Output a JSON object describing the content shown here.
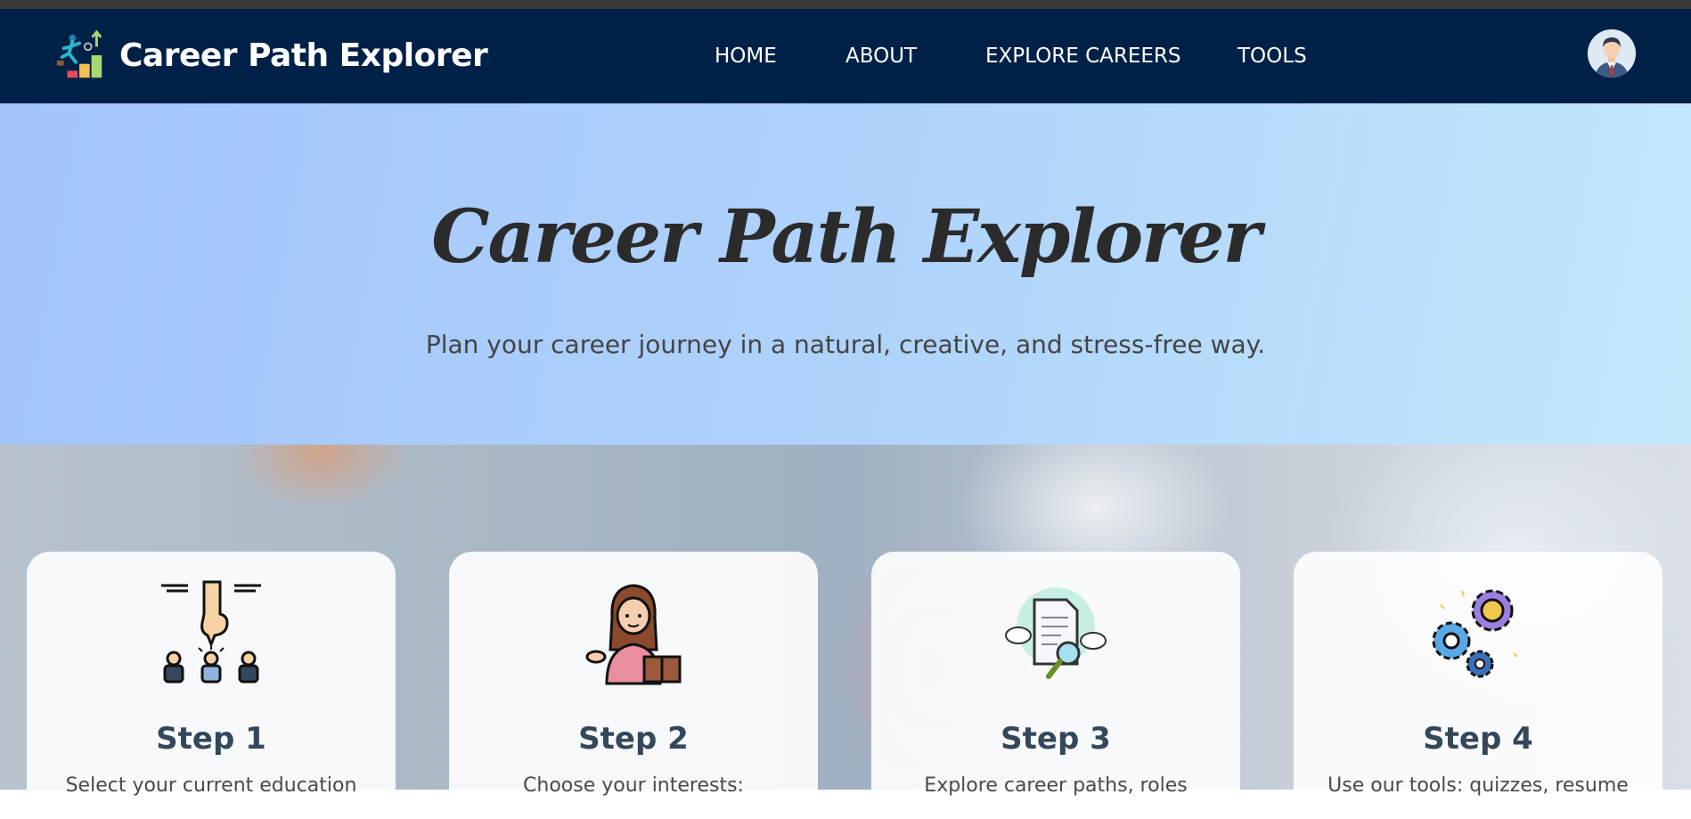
{
  "header": {
    "brand_title": "Career Path Explorer",
    "brand_icon": "career-ladder-runner-icon",
    "nav": [
      "HOME",
      "ABOUT",
      "EXPLORE CAREERS",
      "TOOLS"
    ],
    "avatar_icon": "user-avatar-icon",
    "bg_color": "#002147"
  },
  "hero": {
    "title": "Career Path Explorer",
    "subtitle": "Plan your career journey in a natural, creative, and stress-free way."
  },
  "steps": [
    {
      "title": "Step 1",
      "text": "Select your current education",
      "icon": "selection-pointer-icon"
    },
    {
      "title": "Step 2",
      "text": "Choose your interests:",
      "icon": "woman-reading-icon"
    },
    {
      "title": "Step 3",
      "text": "Explore career paths, roles",
      "icon": "document-search-icon"
    },
    {
      "title": "Step 4",
      "text": "Use our tools: quizzes, resume",
      "icon": "gears-idea-icon"
    }
  ]
}
